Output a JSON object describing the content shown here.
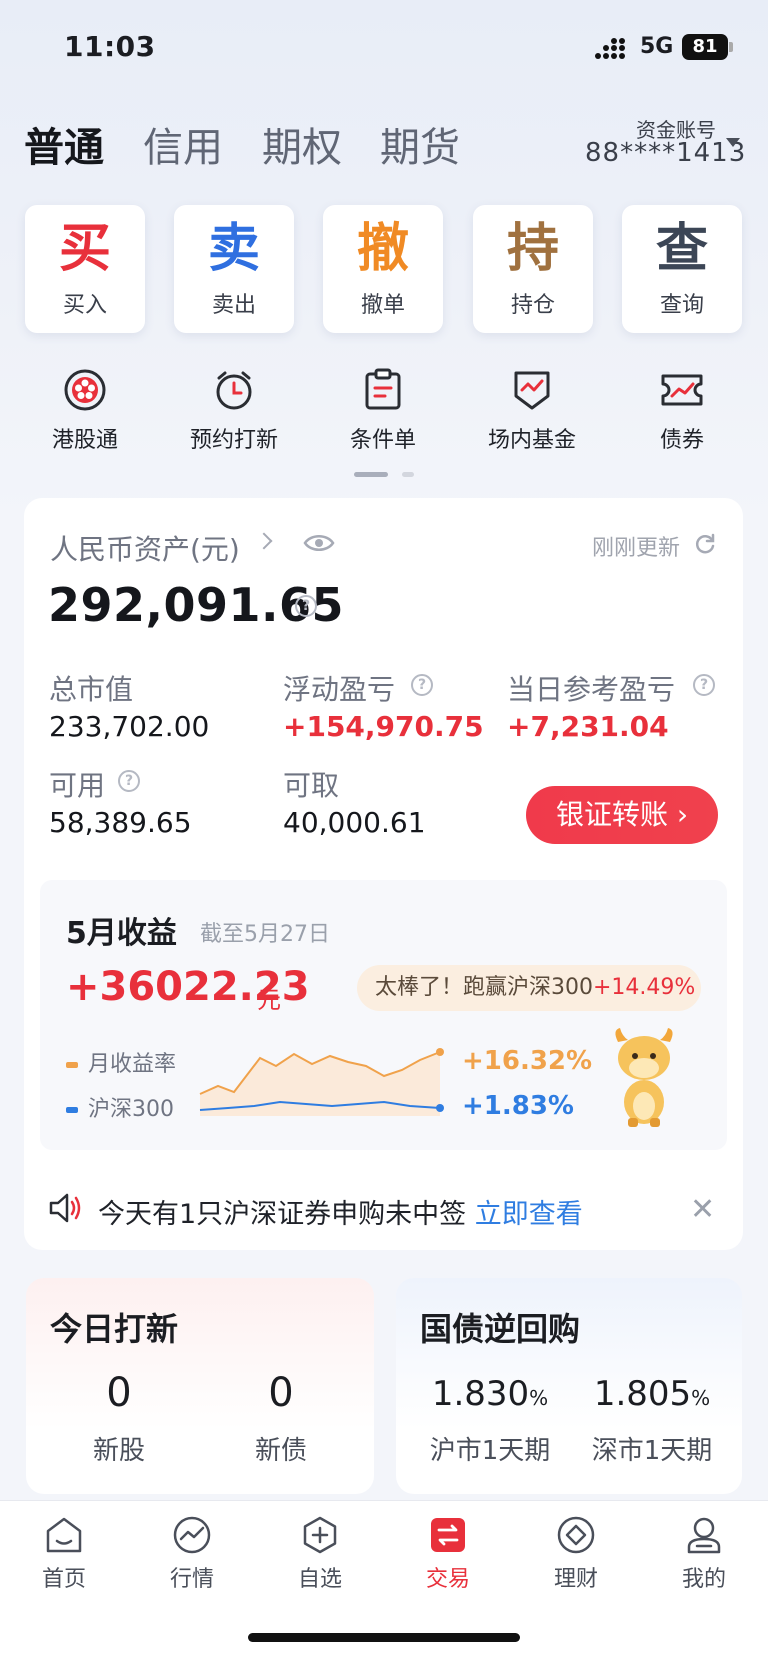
{
  "status_bar": {
    "time": "11:03",
    "network": "5G",
    "battery": "81"
  },
  "tabs": [
    "普通",
    "信用",
    "期权",
    "期货"
  ],
  "account": {
    "label": "资金账号",
    "number": "88****1413"
  },
  "actions": [
    {
      "big": "买",
      "label": "买入",
      "color": "#e8303b"
    },
    {
      "big": "卖",
      "label": "卖出",
      "color": "#2f6fe0"
    },
    {
      "big": "撤",
      "label": "撤单",
      "color": "#f08a24"
    },
    {
      "big": "持",
      "label": "持仓",
      "color": "#a0713f"
    },
    {
      "big": "查",
      "label": "查询",
      "color": "#3c4656"
    }
  ],
  "shortcuts": [
    "港股通",
    "预约打新",
    "条件单",
    "场内基金",
    "债券"
  ],
  "assets": {
    "title": "人民币资产(元)",
    "updated": "刚刚更新",
    "total": "292,091.65",
    "market_value_label": "总市值",
    "market_value": "233,702.00",
    "floating_pl_label": "浮动盈亏",
    "floating_pl": "+154,970.75",
    "daily_pl_label": "当日参考盈亏",
    "daily_pl": "+7,231.04",
    "available_label": "可用",
    "available": "58,389.65",
    "withdrawable_label": "可取",
    "withdrawable": "40,000.61",
    "transfer_button": "银证转账"
  },
  "monthly": {
    "title": "5月收益",
    "as_of": "截至5月27日",
    "value": "+36022.23",
    "unit": "元",
    "bubble_prefix": "太棒了！跑赢沪深300",
    "bubble_highlight": "+14.49%",
    "legend_return": "月收益率",
    "legend_index": "沪深300",
    "return_pct": "+16.32%",
    "index_pct": "+1.83%",
    "color_return": "#f0a24b",
    "color_index": "#2f7de1"
  },
  "notice": {
    "text": "今天有1只沪深证券申购未中签",
    "link": "立即查看"
  },
  "ipo": {
    "title": "今日打新",
    "stock_count": "0",
    "stock_label": "新股",
    "bond_count": "0",
    "bond_label": "新债"
  },
  "repo": {
    "title": "国债逆回购",
    "sh_rate": "1.830",
    "sh_label": "沪市1天期",
    "sz_rate": "1.805",
    "sz_label": "深市1天期",
    "percent": "%"
  },
  "nav": [
    {
      "label": "首页",
      "icon": "home-icon"
    },
    {
      "label": "行情",
      "icon": "market-icon"
    },
    {
      "label": "自选",
      "icon": "watchlist-icon"
    },
    {
      "label": "交易",
      "icon": "trade-icon"
    },
    {
      "label": "理财",
      "icon": "wealth-icon"
    },
    {
      "label": "我的",
      "icon": "profile-icon"
    }
  ]
}
